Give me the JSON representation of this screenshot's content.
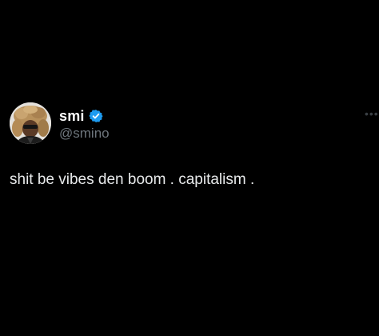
{
  "tweet": {
    "display_name": "smi",
    "handle": "@smino",
    "verified": true,
    "text": "shit be vibes den boom . capitalism .",
    "more_glyph": "•••"
  },
  "icons": {
    "verified": "verified-badge-icon",
    "more": "more-options-icon",
    "avatar": "profile-avatar"
  },
  "colors": {
    "background": "#000000",
    "name": "#ffffff",
    "handle": "#6e767d",
    "text": "#e7e9ea",
    "verified_badge": "#1d9bf0"
  }
}
